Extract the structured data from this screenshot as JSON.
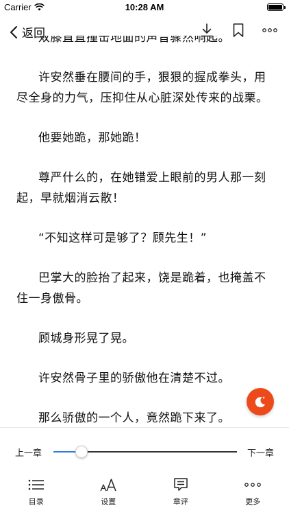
{
  "status": {
    "carrier": "Carrier",
    "time": "10:28 AM"
  },
  "nav": {
    "back_label": "返回"
  },
  "reader": {
    "paragraphs": [
      "双膝直直撞击地面的声音骤然响起。",
      "许安然垂在腰间的手，狠狠的握成拳头，用尽全身的力气，压抑住从心脏深处传来的战栗。",
      "他要她跪，那她跪！",
      "尊严什么的，在她错爱上眼前的男人那一刻起，早就烟消云散！",
      "“不知这样可是够了？顾先生！”",
      "巴掌大的脸抬了起来，饶是跪着，也掩盖不住一身傲骨。",
      "顾城身形晃了晃。",
      "许安然骨子里的骄傲他在清楚不过。",
      "那么骄傲的一个人，竟然跪下来了。"
    ]
  },
  "chapter_nav": {
    "prev_label": "上一章",
    "next_label": "下一章",
    "progress": 0.15
  },
  "tabs": [
    {
      "label": "目录",
      "icon": "list-icon"
    },
    {
      "label": "设置",
      "icon": "font-size-icon"
    },
    {
      "label": "章评",
      "icon": "comment-icon"
    },
    {
      "label": "更多",
      "icon": "more-icon"
    }
  ],
  "colors": {
    "accent": "#2f7de1",
    "night_button": "#ec4a1a"
  }
}
